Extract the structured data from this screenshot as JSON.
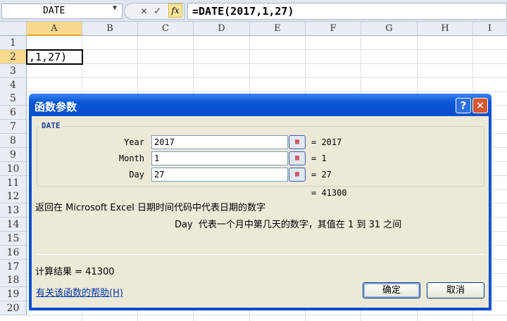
{
  "formula_bar": {
    "name_box": "DATE",
    "formula": "=DATE(2017,1,27)",
    "cancel_icon": "✕",
    "enter_icon": "✓",
    "fx_label": "fx"
  },
  "columns": [
    "A",
    "B",
    "C",
    "D",
    "E",
    "F",
    "G",
    "H",
    "I"
  ],
  "rows": [
    "1",
    "2",
    "3",
    "4",
    "5",
    "6",
    "7",
    "8",
    "9",
    "10",
    "11",
    "12",
    "13",
    "14",
    "15",
    "16",
    "17",
    "18",
    "19",
    "20"
  ],
  "cell_a2": ",1,27)",
  "dialog": {
    "title": "函数参数",
    "help_btn": "?",
    "close_btn": "✕",
    "function_name": "DATE",
    "args": [
      {
        "label": "Year",
        "value": "2017",
        "result": "= 2017"
      },
      {
        "label": "Month",
        "value": "1",
        "result": "= 1"
      },
      {
        "label": "Day",
        "value": "27",
        "result": "= 27"
      }
    ],
    "formula_result": "= 41300",
    "description": "返回在 Microsoft Excel 日期时间代码中代表日期的数字",
    "arg_description": "Day  代表一个月中第几天的数字，其值在 1 到 31 之间",
    "calc_result": "计算结果 = 41300",
    "help_link": "有关该函数的帮助(H)",
    "ok": "确定",
    "cancel": "取消"
  }
}
